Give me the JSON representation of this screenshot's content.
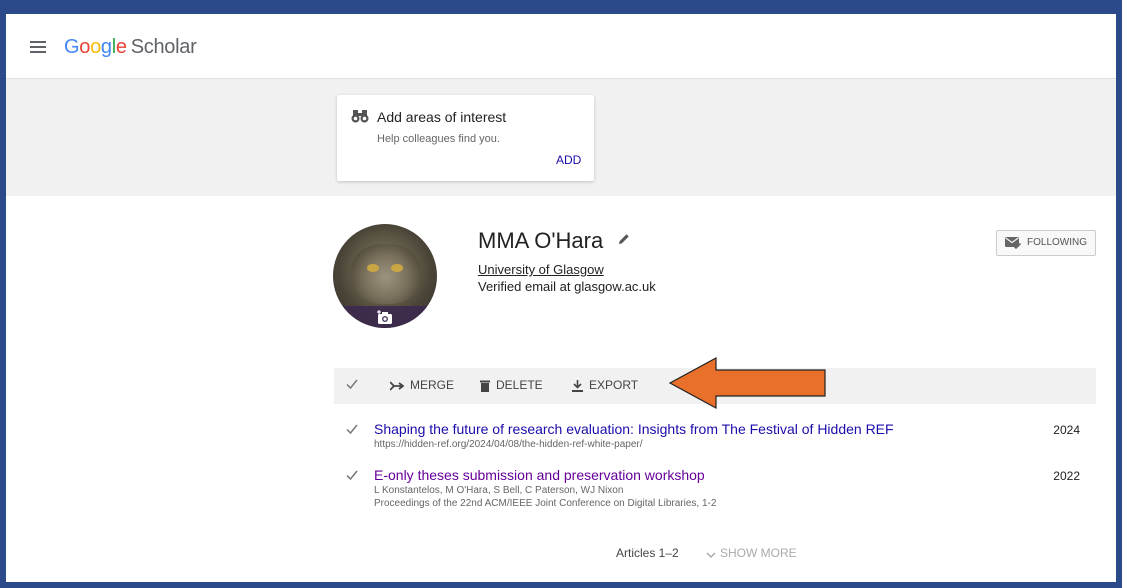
{
  "header": {
    "logo_google": "Google",
    "logo_scholar": "Scholar"
  },
  "interest_card": {
    "title": "Add areas of interest",
    "subtitle": "Help colleagues find you.",
    "add_label": "ADD"
  },
  "profile": {
    "name": "MMA O'Hara",
    "affiliation": "University of Glasgow",
    "email": "Verified email at glasgow.ac.uk",
    "follow_label": "FOLLOWING"
  },
  "toolbar": {
    "merge_label": "MERGE",
    "delete_label": "DELETE",
    "export_label": "EXPORT"
  },
  "annotation": {
    "arrow_color": "#e8702a"
  },
  "articles": [
    {
      "title": "Shaping the future of research evaluation: Insights from The Festival of Hidden REF",
      "line1": "https://hidden-ref.org/2024/04/08/the-hidden-ref-white-paper/",
      "line2": "",
      "year": "2024"
    },
    {
      "title": "E-only theses submission and preservation workshop",
      "line1": "L Konstantelos, M O'Hara, S Bell, C Paterson, WJ Nixon",
      "line2": "Proceedings of the 22nd ACM/IEEE Joint Conference on Digital Libraries, 1-2",
      "year": "2022"
    }
  ],
  "footer": {
    "articles_count": "Articles 1–2",
    "show_more": "SHOW MORE"
  }
}
